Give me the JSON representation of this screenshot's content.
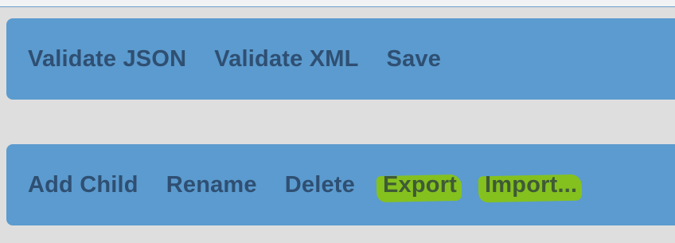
{
  "top_toolbar": {
    "items": [
      {
        "label": "Validate JSON"
      },
      {
        "label": "Validate XML"
      },
      {
        "label": "Save"
      }
    ]
  },
  "node_toolbar": {
    "items": [
      {
        "label": "Add Child"
      },
      {
        "label": "Rename"
      },
      {
        "label": "Delete"
      },
      {
        "label": "Export",
        "highlighted": true
      },
      {
        "label": "Import...",
        "highlighted": true
      }
    ]
  },
  "colors": {
    "toolbar_bg": "#5b9bcf",
    "button_text": "#2f4f72",
    "page_bg": "#dedede",
    "highlight": "#8cc800"
  }
}
